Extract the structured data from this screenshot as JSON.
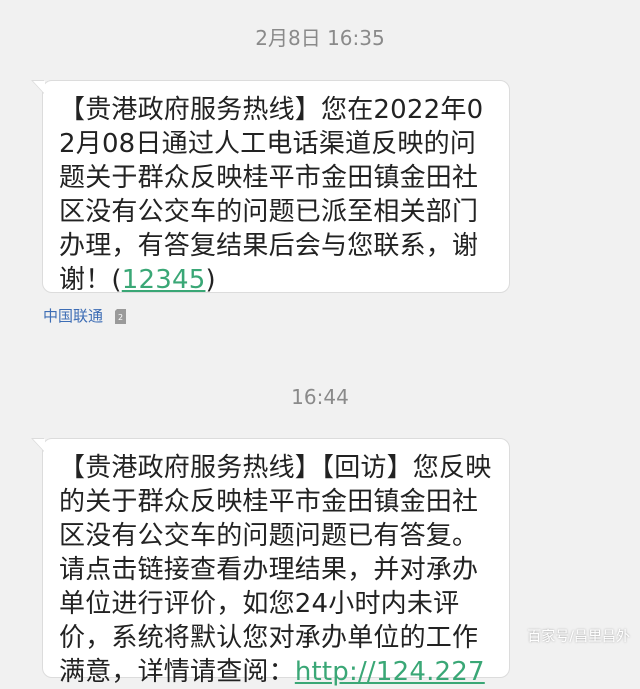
{
  "thread": {
    "messages": [
      {
        "timestamp": "2月8日 16:35",
        "text_before_link": "【贵港政府服务热线】您在2022年02月08日通过人工电话渠道反映的问题关于群众反映桂平市金田镇金田社区没有公交车的问题已派至相关部门办理，有答复结果后会与您联系，谢谢！(",
        "link": "12345",
        "text_after_link": ")",
        "carrier": "中国联通",
        "sim_icon": "sim-card-2-icon"
      },
      {
        "timestamp": "16:44",
        "text_before_link": "【贵港政府服务热线】【回访】您反映的关于群众反映桂平市金田镇金田社区没有公交车的问题问题已有答复。请点击链接查看办理结果，并对承办单位进行评价，如您24小时内未评价，系统将默认您对承办单位的工作满意，详情请查阅：",
        "link": "http://124.227"
      }
    ]
  },
  "watermark": "百家号/昌里昌外",
  "colors": {
    "background": "#f1f1f1",
    "bubble": "#ffffff",
    "link": "#3aa776",
    "carrier": "#3d6db5",
    "timestamp": "#8a8a8a"
  }
}
